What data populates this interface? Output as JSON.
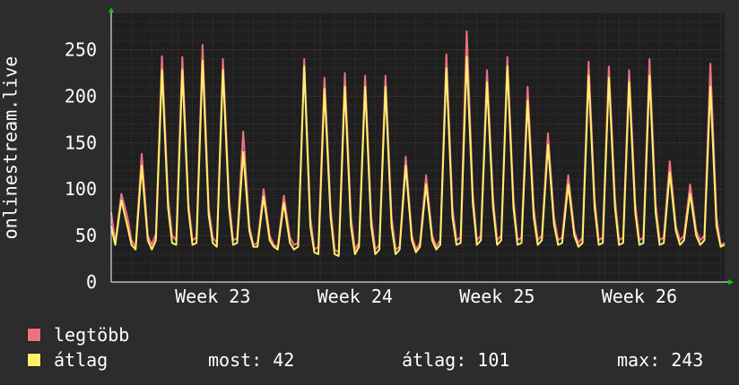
{
  "chart_data": {
    "type": "line",
    "ylabel": "onlinestream.live",
    "ylim": [
      0,
      290
    ],
    "yticks": [
      0,
      50,
      100,
      150,
      200,
      250
    ],
    "x_ticks": [
      "Week 23",
      "Week 24",
      "Week 25",
      "Week 26"
    ],
    "grid": true,
    "days": 29,
    "series": [
      {
        "name": "legtöbb",
        "color": "#f07280",
        "values": [
          [
            0,
            75
          ],
          [
            0.2,
            42
          ],
          [
            0.5,
            95
          ],
          [
            0.8,
            70
          ],
          [
            1,
            45
          ],
          [
            1.2,
            38
          ],
          [
            1.5,
            138
          ],
          [
            1.8,
            50
          ],
          [
            2,
            40
          ],
          [
            2.2,
            52
          ],
          [
            2.5,
            243
          ],
          [
            2.8,
            90
          ],
          [
            3,
            50
          ],
          [
            3.2,
            45
          ],
          [
            3.5,
            242
          ],
          [
            3.8,
            85
          ],
          [
            4,
            45
          ],
          [
            4.2,
            48
          ],
          [
            4.5,
            255
          ],
          [
            4.8,
            80
          ],
          [
            5,
            48
          ],
          [
            5.2,
            42
          ],
          [
            5.5,
            240
          ],
          [
            5.8,
            90
          ],
          [
            6,
            45
          ],
          [
            6.2,
            47
          ],
          [
            6.5,
            162
          ],
          [
            6.8,
            60
          ],
          [
            7,
            40
          ],
          [
            7.2,
            42
          ],
          [
            7.5,
            100
          ],
          [
            7.8,
            50
          ],
          [
            8,
            40
          ],
          [
            8.2,
            38
          ],
          [
            8.5,
            93
          ],
          [
            8.8,
            48
          ],
          [
            9,
            40
          ],
          [
            9.2,
            42
          ],
          [
            9.5,
            240
          ],
          [
            9.8,
            70
          ],
          [
            10,
            35
          ],
          [
            10.2,
            38
          ],
          [
            10.5,
            220
          ],
          [
            10.8,
            80
          ],
          [
            11,
            35
          ],
          [
            11.2,
            32
          ],
          [
            11.5,
            225
          ],
          [
            11.8,
            70
          ],
          [
            12,
            35
          ],
          [
            12.2,
            42
          ],
          [
            12.5,
            222
          ],
          [
            12.8,
            70
          ],
          [
            13,
            35
          ],
          [
            13.2,
            40
          ],
          [
            13.5,
            222
          ],
          [
            13.8,
            70
          ],
          [
            14,
            35
          ],
          [
            14.2,
            38
          ],
          [
            14.5,
            135
          ],
          [
            14.8,
            50
          ],
          [
            15,
            35
          ],
          [
            15.2,
            42
          ],
          [
            15.5,
            115
          ],
          [
            15.8,
            50
          ],
          [
            16,
            38
          ],
          [
            16.2,
            45
          ],
          [
            16.5,
            245
          ],
          [
            16.8,
            80
          ],
          [
            17,
            45
          ],
          [
            17.2,
            48
          ],
          [
            17.5,
            270
          ],
          [
            17.8,
            95
          ],
          [
            18,
            45
          ],
          [
            18.2,
            50
          ],
          [
            18.5,
            228
          ],
          [
            18.8,
            90
          ],
          [
            19,
            45
          ],
          [
            19.2,
            50
          ],
          [
            19.5,
            242
          ],
          [
            19.8,
            90
          ],
          [
            20,
            45
          ],
          [
            20.2,
            48
          ],
          [
            20.5,
            210
          ],
          [
            20.8,
            80
          ],
          [
            21,
            45
          ],
          [
            21.2,
            50
          ],
          [
            21.5,
            160
          ],
          [
            21.8,
            70
          ],
          [
            22,
            45
          ],
          [
            22.2,
            48
          ],
          [
            22.5,
            115
          ],
          [
            22.8,
            55
          ],
          [
            23,
            42
          ],
          [
            23.2,
            48
          ],
          [
            23.5,
            237
          ],
          [
            23.8,
            90
          ],
          [
            24,
            45
          ],
          [
            24.2,
            48
          ],
          [
            24.5,
            232
          ],
          [
            24.8,
            90
          ],
          [
            25,
            45
          ],
          [
            25.2,
            48
          ],
          [
            25.5,
            228
          ],
          [
            25.8,
            85
          ],
          [
            26,
            45
          ],
          [
            26.2,
            48
          ],
          [
            26.5,
            240
          ],
          [
            26.8,
            85
          ],
          [
            27,
            45
          ],
          [
            27.2,
            48
          ],
          [
            27.5,
            130
          ],
          [
            27.8,
            60
          ],
          [
            28,
            45
          ],
          [
            28.2,
            50
          ],
          [
            28.5,
            105
          ],
          [
            28.8,
            55
          ],
          [
            29,
            45
          ],
          [
            29.2,
            50
          ],
          [
            29.5,
            235
          ],
          [
            29.8,
            70
          ],
          [
            30,
            40
          ],
          [
            30.2,
            42
          ]
        ]
      },
      {
        "name": "átlag",
        "color": "#fff06a",
        "values": [
          [
            0,
            60
          ],
          [
            0.2,
            40
          ],
          [
            0.5,
            88
          ],
          [
            0.8,
            60
          ],
          [
            1,
            40
          ],
          [
            1.2,
            35
          ],
          [
            1.5,
            125
          ],
          [
            1.8,
            45
          ],
          [
            2,
            35
          ],
          [
            2.2,
            45
          ],
          [
            2.5,
            228
          ],
          [
            2.8,
            80
          ],
          [
            3,
            42
          ],
          [
            3.2,
            40
          ],
          [
            3.5,
            228
          ],
          [
            3.8,
            78
          ],
          [
            4,
            40
          ],
          [
            4.2,
            42
          ],
          [
            4.5,
            238
          ],
          [
            4.8,
            72
          ],
          [
            5,
            42
          ],
          [
            5.2,
            38
          ],
          [
            5.5,
            228
          ],
          [
            5.8,
            80
          ],
          [
            6,
            40
          ],
          [
            6.2,
            42
          ],
          [
            6.5,
            140
          ],
          [
            6.8,
            55
          ],
          [
            7,
            38
          ],
          [
            7.2,
            38
          ],
          [
            7.5,
            92
          ],
          [
            7.8,
            45
          ],
          [
            8,
            38
          ],
          [
            8.2,
            35
          ],
          [
            8.5,
            85
          ],
          [
            8.8,
            42
          ],
          [
            9,
            35
          ],
          [
            9.2,
            38
          ],
          [
            9.5,
            232
          ],
          [
            9.8,
            60
          ],
          [
            10,
            32
          ],
          [
            10.2,
            30
          ],
          [
            10.5,
            208
          ],
          [
            10.8,
            70
          ],
          [
            11,
            30
          ],
          [
            11.2,
            28
          ],
          [
            11.5,
            210
          ],
          [
            11.8,
            60
          ],
          [
            12,
            30
          ],
          [
            12.2,
            38
          ],
          [
            12.5,
            210
          ],
          [
            12.8,
            60
          ],
          [
            13,
            30
          ],
          [
            13.2,
            35
          ],
          [
            13.5,
            210
          ],
          [
            13.8,
            60
          ],
          [
            14,
            30
          ],
          [
            14.2,
            35
          ],
          [
            14.5,
            125
          ],
          [
            14.8,
            45
          ],
          [
            15,
            32
          ],
          [
            15.2,
            38
          ],
          [
            15.5,
            105
          ],
          [
            15.8,
            45
          ],
          [
            16,
            35
          ],
          [
            16.2,
            40
          ],
          [
            16.5,
            230
          ],
          [
            16.8,
            70
          ],
          [
            17,
            40
          ],
          [
            17.2,
            42
          ],
          [
            17.5,
            242
          ],
          [
            17.8,
            85
          ],
          [
            18,
            40
          ],
          [
            18.2,
            45
          ],
          [
            18.5,
            215
          ],
          [
            18.8,
            80
          ],
          [
            19,
            40
          ],
          [
            19.2,
            45
          ],
          [
            19.5,
            232
          ],
          [
            19.8,
            80
          ],
          [
            20,
            40
          ],
          [
            20.2,
            42
          ],
          [
            20.5,
            195
          ],
          [
            20.8,
            70
          ],
          [
            21,
            40
          ],
          [
            21.2,
            45
          ],
          [
            21.5,
            148
          ],
          [
            21.8,
            62
          ],
          [
            22,
            40
          ],
          [
            22.2,
            42
          ],
          [
            22.5,
            105
          ],
          [
            22.8,
            50
          ],
          [
            23,
            38
          ],
          [
            23.2,
            42
          ],
          [
            23.5,
            222
          ],
          [
            23.8,
            80
          ],
          [
            24,
            40
          ],
          [
            24.2,
            42
          ],
          [
            24.5,
            220
          ],
          [
            24.8,
            80
          ],
          [
            25,
            40
          ],
          [
            25.2,
            42
          ],
          [
            25.5,
            215
          ],
          [
            25.8,
            75
          ],
          [
            26,
            40
          ],
          [
            26.2,
            42
          ],
          [
            26.5,
            222
          ],
          [
            26.8,
            75
          ],
          [
            27,
            40
          ],
          [
            27.2,
            42
          ],
          [
            27.5,
            118
          ],
          [
            27.8,
            55
          ],
          [
            28,
            40
          ],
          [
            28.2,
            45
          ],
          [
            28.5,
            95
          ],
          [
            28.8,
            50
          ],
          [
            29,
            40
          ],
          [
            29.2,
            45
          ],
          [
            29.5,
            210
          ],
          [
            29.8,
            60
          ],
          [
            30,
            38
          ],
          [
            30.2,
            40
          ]
        ]
      }
    ],
    "stats": {
      "most": "42",
      "atlag": "101",
      "max": "243"
    }
  },
  "legend": [
    {
      "label": "legtöbb",
      "color": "#f07280"
    },
    {
      "label": "átlag",
      "color": "#fff06a"
    }
  ],
  "stats_labels": {
    "most": "most: 42",
    "atlag": "átlag: 101",
    "max": "max: 243"
  }
}
